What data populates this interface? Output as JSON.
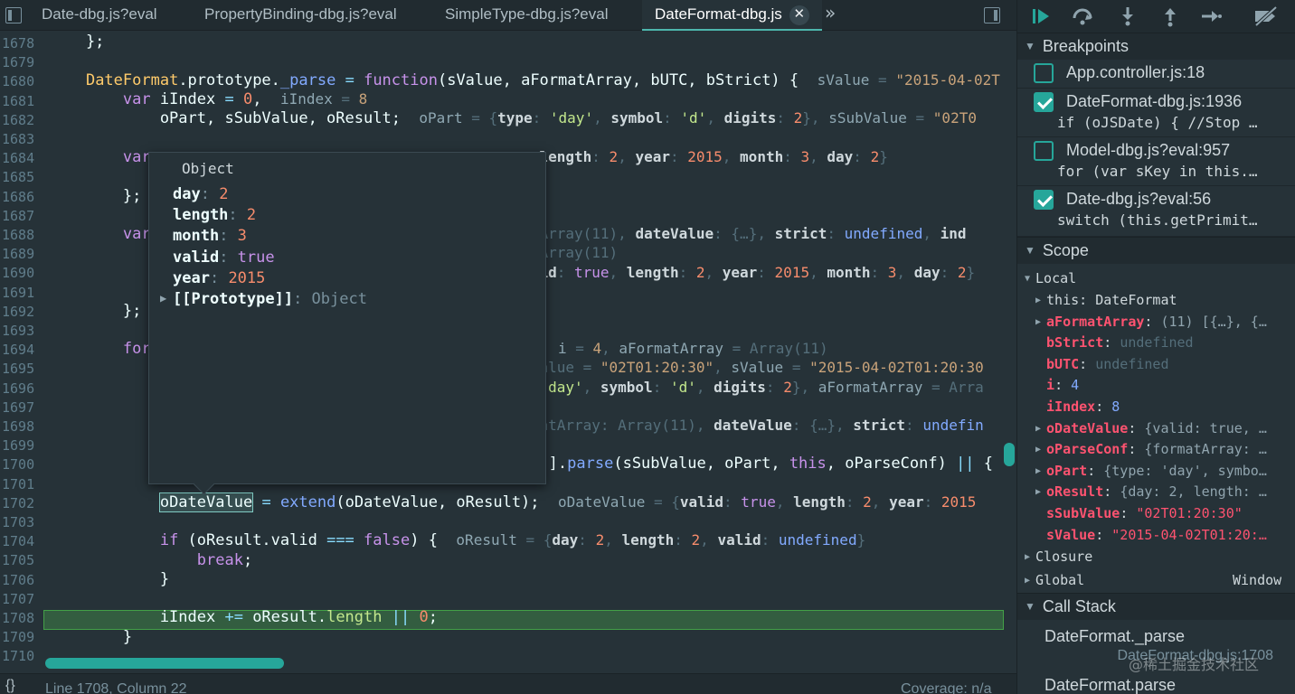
{
  "tabs": [
    {
      "label": "Date-dbg.js?eval"
    },
    {
      "label": "PropertyBinding-dbg.js?eval"
    },
    {
      "label": "SimpleType-dbg.js?eval"
    },
    {
      "label": "DateFormat-dbg.js",
      "active": true
    }
  ],
  "tab_close_glyph": "✕",
  "tab_more_glyph": "»",
  "editor": {
    "lines": [
      {
        "n": "1678"
      },
      {
        "n": "1679"
      },
      {
        "n": "1680"
      },
      {
        "n": "1681"
      },
      {
        "n": "1682"
      },
      {
        "n": "1683"
      },
      {
        "n": "1684"
      },
      {
        "n": "1685"
      },
      {
        "n": "1686"
      },
      {
        "n": "1687"
      },
      {
        "n": "1688"
      },
      {
        "n": "1689"
      },
      {
        "n": "1690"
      },
      {
        "n": "1691"
      },
      {
        "n": "1692"
      },
      {
        "n": "1693"
      },
      {
        "n": "1694"
      },
      {
        "n": "1695"
      },
      {
        "n": "1696"
      },
      {
        "n": "1697"
      },
      {
        "n": "1698"
      },
      {
        "n": "1699"
      },
      {
        "n": "1700"
      },
      {
        "n": "1701"
      },
      {
        "n": "1702"
      },
      {
        "n": "1703"
      },
      {
        "n": "1704"
      },
      {
        "n": "1705"
      },
      {
        "n": "1706"
      },
      {
        "n": "1707"
      },
      {
        "n": "1708"
      },
      {
        "n": "1709"
      },
      {
        "n": "1710"
      }
    ],
    "current_line": "1708"
  },
  "popover": {
    "title": "Object",
    "rows": [
      {
        "key": "day",
        "value": "2",
        "kind": "num"
      },
      {
        "key": "length",
        "value": "2",
        "kind": "num"
      },
      {
        "key": "month",
        "value": "3",
        "kind": "num"
      },
      {
        "key": "valid",
        "value": "true",
        "kind": "kw"
      },
      {
        "key": "year",
        "value": "2015",
        "kind": "num"
      }
    ],
    "proto_key": "[[Prototype]]",
    "proto_value": "Object"
  },
  "status": {
    "braces": "{}",
    "position": "Line 1708, Column 22",
    "coverage": "Coverage: n/a"
  },
  "breakpoints": {
    "title": "Breakpoints",
    "items": [
      {
        "location": "App.controller.js:18",
        "snippet": "",
        "checked": false
      },
      {
        "location": "DateFormat-dbg.js:1936",
        "snippet": "if (oJSDate) { //Stop …",
        "checked": true
      },
      {
        "location": "Model-dbg.js?eval:957",
        "snippet": "for (var sKey in this.…",
        "checked": false
      },
      {
        "location": "Date-dbg.js?eval:56",
        "snippet": "switch (this.getPrimit…",
        "checked": true
      }
    ]
  },
  "scope": {
    "title": "Scope",
    "local_label": "Local",
    "vars": [
      {
        "key": "this",
        "value": "DateFormat",
        "expandable": true,
        "style": "plain",
        "vstyle": "plain"
      },
      {
        "key": "aFormatArray",
        "value": "(11) [{…}, {…",
        "expandable": true,
        "style": "own",
        "vstyle": "obj"
      },
      {
        "key": "bStrict",
        "value": "undefined",
        "expandable": false,
        "style": "own",
        "vstyle": "dim"
      },
      {
        "key": "bUTC",
        "value": "undefined",
        "expandable": false,
        "style": "own",
        "vstyle": "dim"
      },
      {
        "key": "i",
        "value": "4",
        "expandable": false,
        "style": "own",
        "vstyle": "num"
      },
      {
        "key": "iIndex",
        "value": "8",
        "expandable": false,
        "style": "own",
        "vstyle": "num"
      },
      {
        "key": "oDateValue",
        "value": "{valid: true, …",
        "expandable": true,
        "style": "own",
        "vstyle": "obj"
      },
      {
        "key": "oParseConf",
        "value": "{formatArray: …",
        "expandable": true,
        "style": "own",
        "vstyle": "obj"
      },
      {
        "key": "oPart",
        "value": "{type: 'day', symbo…",
        "expandable": true,
        "style": "own",
        "vstyle": "obj"
      },
      {
        "key": "oResult",
        "value": "{day: 2, length: …",
        "expandable": true,
        "style": "own",
        "vstyle": "obj"
      },
      {
        "key": "sSubValue",
        "value": "\"02T01:20:30\"",
        "expandable": false,
        "style": "own",
        "vstyle": "str"
      },
      {
        "key": "sValue",
        "value": "\"2015-04-02T01:20:…",
        "expandable": false,
        "style": "own",
        "vstyle": "str"
      }
    ],
    "closure_label": "Closure",
    "global_label": "Global",
    "global_value": "Window"
  },
  "call_stack": {
    "title": "Call Stack",
    "frames": [
      {
        "name": "DateFormat._parse",
        "location": "DateFormat-dbg.js:1708"
      },
      {
        "name": "DateFormat.parse",
        "location": ""
      }
    ]
  },
  "watermark": "@稀土掘金技术社区",
  "colors": {
    "accent": "#26a69a",
    "background": "#263238",
    "current_line": "#2e7d32"
  }
}
